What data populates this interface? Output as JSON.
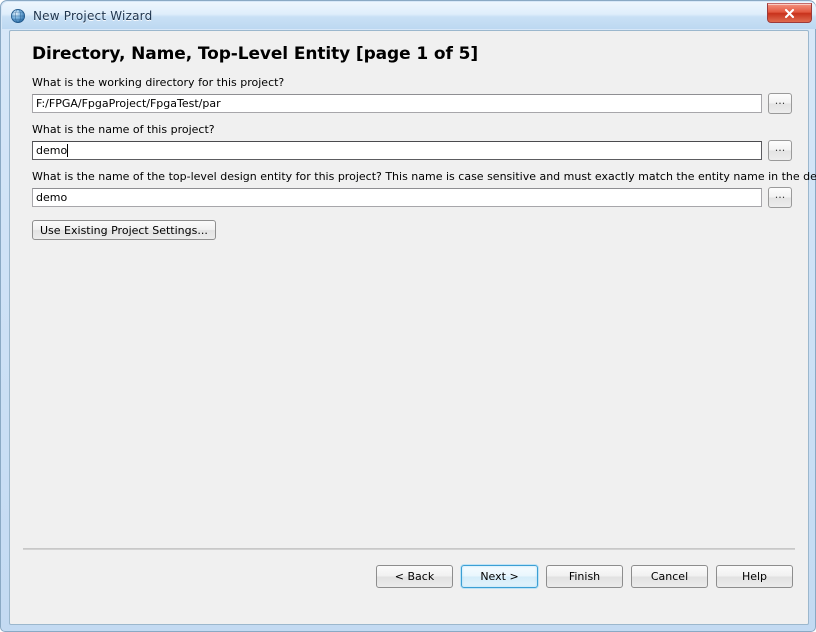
{
  "window": {
    "title": "New Project Wizard",
    "icon": "app-globe-icon",
    "close_label": "x",
    "frame_color": "#c3daf2",
    "titlebar_color": "#bdd8f1",
    "close_color": "#c8321c"
  },
  "page": {
    "heading": "Directory, Name, Top-Level Entity [page 1 of 5]"
  },
  "fields": [
    {
      "label": "What is the working directory for this project?",
      "value": "F:/FPGA/FpgaProject/FpgaTest/par",
      "placeholder": "",
      "browse_label": "...",
      "focused": false
    },
    {
      "label": "What is the name of this project?",
      "value": "demo",
      "placeholder": "",
      "browse_label": "...",
      "focused": true
    },
    {
      "label": "What is the name of the top-level design entity for this project? This name is case sensitive and must exactly match the entity name in the design file.",
      "value": "demo",
      "placeholder": "",
      "browse_label": "...",
      "focused": false
    }
  ],
  "settings_button": {
    "label": "Use Existing Project Settings..."
  },
  "footer": {
    "buttons": [
      {
        "label": "< Back",
        "default": false
      },
      {
        "label": "Next >",
        "default": true
      },
      {
        "label": "Finish",
        "default": false
      },
      {
        "label": "Cancel",
        "default": false
      },
      {
        "label": "Help",
        "default": false
      }
    ],
    "accent_color": "#3c9fd4"
  }
}
